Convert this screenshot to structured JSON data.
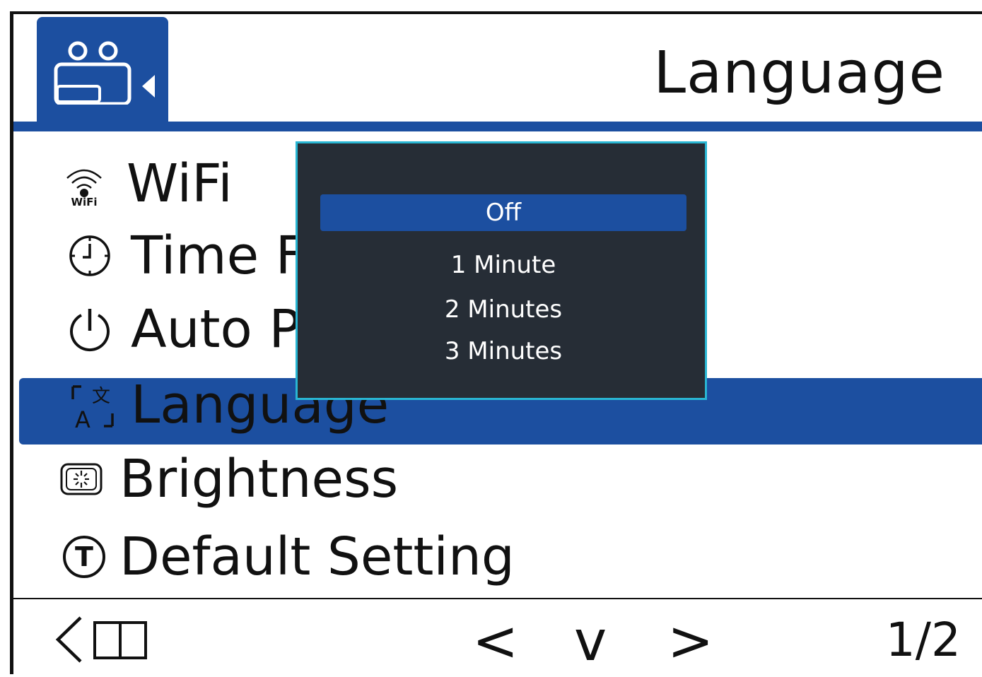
{
  "header": {
    "mode_icon": "camcorder-icon",
    "title": "Language"
  },
  "menu": {
    "items": [
      {
        "icon": "wifi-icon",
        "icon_text": "WiFi",
        "label": "WiFi",
        "selected": false
      },
      {
        "icon": "clock-icon",
        "label": "Time F",
        "selected": false
      },
      {
        "icon": "power-icon",
        "label": "Auto P",
        "selected": false
      },
      {
        "icon": "language-icon",
        "icon_text_top": "文",
        "icon_text_bottom": "A",
        "label": "Language",
        "selected": true
      },
      {
        "icon": "brightness-icon",
        "label": "Brightness",
        "selected": false
      },
      {
        "icon": "default-setting-icon",
        "icon_text": "T",
        "label": "Default Setting",
        "selected": false
      }
    ]
  },
  "popup": {
    "options": [
      {
        "label": "Off",
        "selected": true
      },
      {
        "label": "1 Minute",
        "selected": false
      },
      {
        "label": "2 Minutes",
        "selected": false
      },
      {
        "label": "3 Minutes",
        "selected": false
      }
    ]
  },
  "footer": {
    "back_icon": "back-icon",
    "prev": "<",
    "down": "v",
    "next": ">",
    "page": "1/2"
  },
  "colors": {
    "accent": "#1c4fa0",
    "popup_background": "#262d36",
    "popup_border": "#29b6d3"
  }
}
